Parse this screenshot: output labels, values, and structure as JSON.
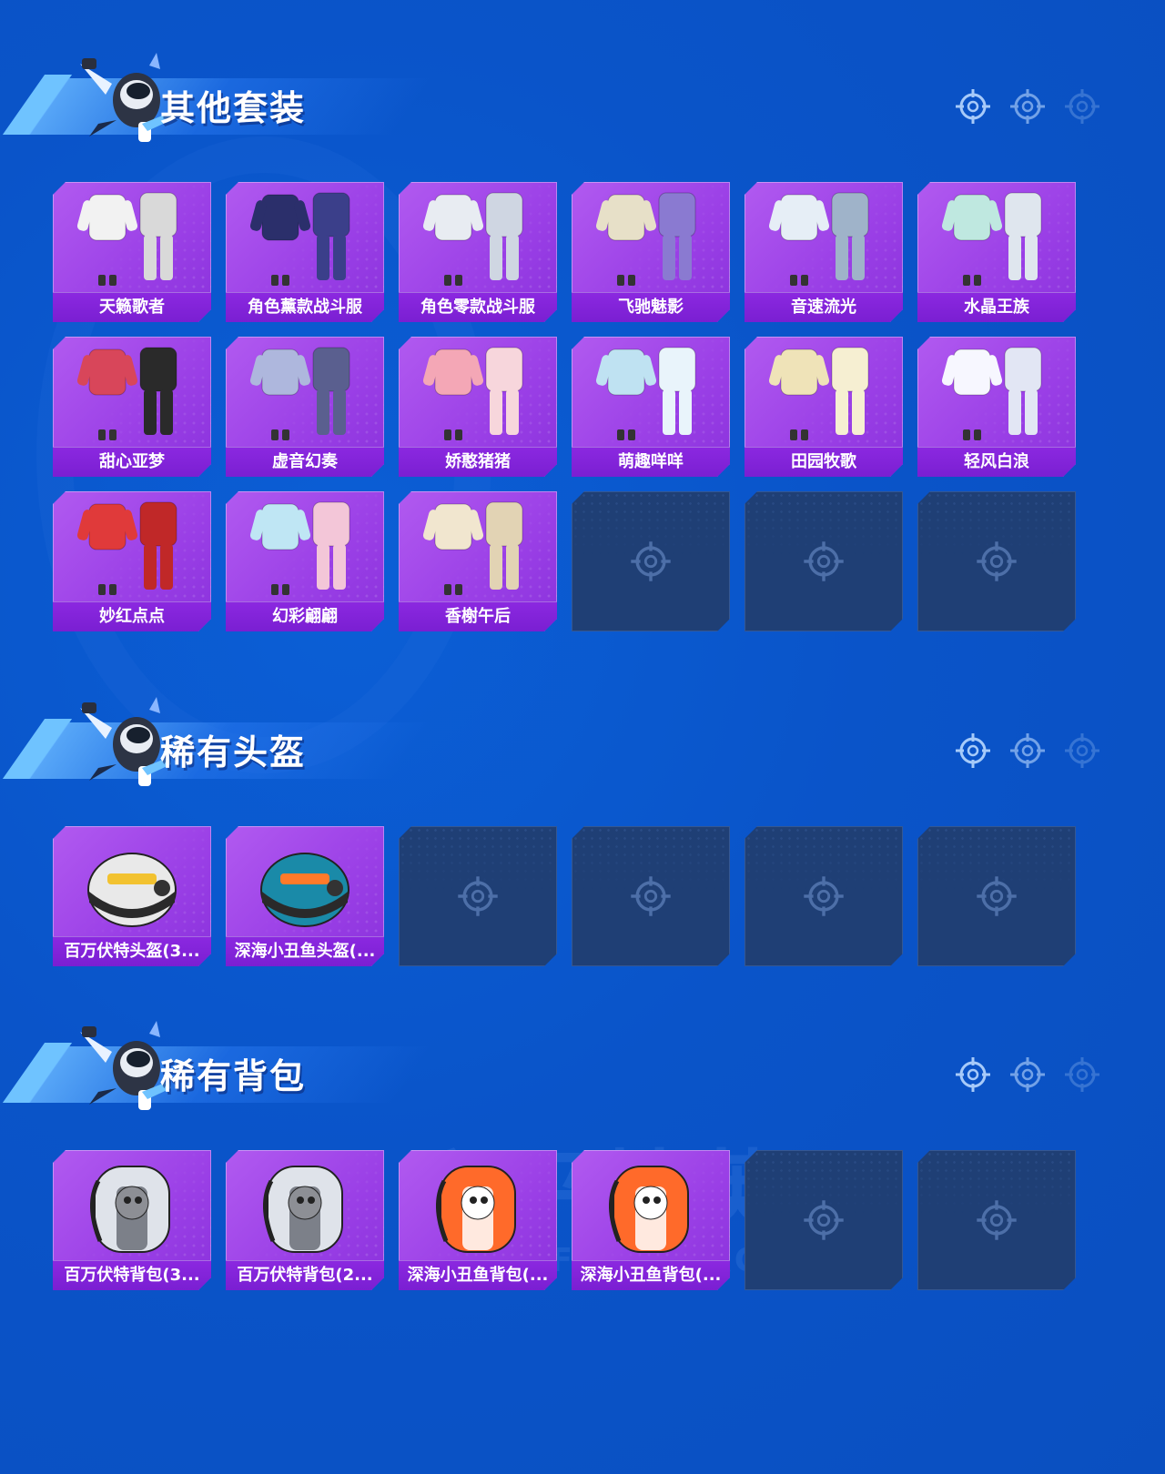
{
  "sections": [
    {
      "title": "其他套装",
      "items": [
        "天籁歌者",
        "角色薰款战斗服",
        "角色零款战斗服",
        "飞驰魅影",
        "音速流光",
        "水晶王族",
        "甜心亚梦",
        "虚音幻奏",
        "娇憨猪猪",
        "萌趣咩咩",
        "田园牧歌",
        "轻风白浪",
        "妙红点点",
        "幻彩翩翩",
        "香榭午后"
      ],
      "empty_slots": 3
    },
    {
      "title": "稀有头盔",
      "items": [
        "百万伏特头盔(3...",
        "深海小丑鱼头盔(..."
      ],
      "empty_slots": 4
    },
    {
      "title": "稀有背包",
      "items": [
        "百万伏特背包(3...",
        "百万伏特背包(2...",
        "深海小丑鱼背包(...",
        "深海小丑鱼背包(..."
      ],
      "empty_slots": 2
    }
  ],
  "watermark": {
    "line1": "和平精英",
    "line2": "GAME FOR PEACE"
  },
  "colors": {
    "background": "#0a54c9",
    "card": "#9a3fe6",
    "label": "#7a1fd2",
    "empty": "#1f3f75"
  }
}
